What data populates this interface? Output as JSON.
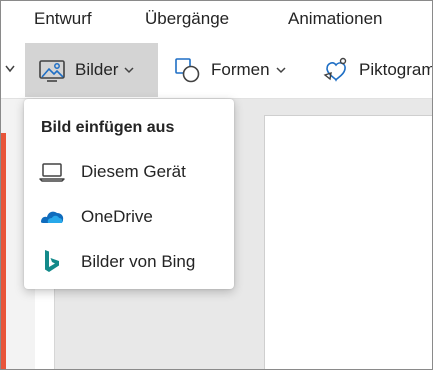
{
  "ribbon": {
    "tabs": [
      {
        "label": "Entwurf"
      },
      {
        "label": "Übergänge"
      },
      {
        "label": "Animationen"
      }
    ]
  },
  "toolbar": {
    "pictures_label": "Bilder",
    "shapes_label": "Formen",
    "icons_label": "Piktogramme"
  },
  "insert_picture_menu": {
    "heading": "Bild einfügen aus",
    "items": [
      {
        "label": "Diesem Gerät",
        "icon": "laptop-icon"
      },
      {
        "label": "OneDrive",
        "icon": "onedrive-cloud-icon"
      },
      {
        "label": "Bilder von Bing",
        "icon": "bing-logo-icon"
      }
    ]
  },
  "colors": {
    "active_button": "#d4d4d4",
    "onedrive_blue": "#0f6cbd",
    "bing_teal": "#138a8a",
    "thumbnail_accent": "#e8553a",
    "icon_blue": "#1f6fc5"
  }
}
